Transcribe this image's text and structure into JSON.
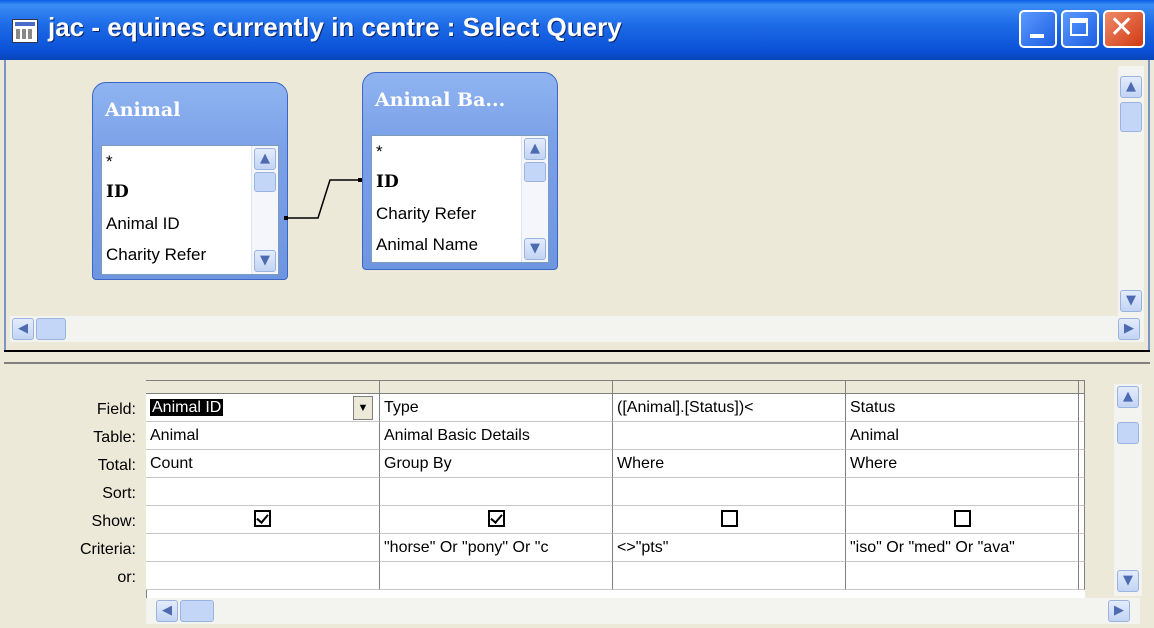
{
  "window": {
    "title": "jac - equines currently in centre : Select Query"
  },
  "tables": [
    {
      "title": "Animal",
      "fields": [
        "*",
        "ID",
        "Animal ID",
        "Charity Refer"
      ]
    },
    {
      "title": "Animal Ba...",
      "fields": [
        "*",
        "ID",
        "Charity Refer",
        "Animal Name"
      ]
    }
  ],
  "grid": {
    "row_labels": [
      "Field:",
      "Table:",
      "Total:",
      "Sort:",
      "Show:",
      "Criteria:",
      "or:"
    ],
    "columns": [
      {
        "field": "Animal ID",
        "table": "Animal",
        "total": "Count",
        "sort": "",
        "show": true,
        "criteria": "",
        "or": ""
      },
      {
        "field": "Type",
        "table": "Animal Basic Details",
        "total": "Group By",
        "sort": "",
        "show": true,
        "criteria": "\"horse\" Or \"pony\" Or \"c",
        "or": ""
      },
      {
        "field": "([Animal].[Status])<",
        "table": "",
        "total": "Where",
        "sort": "",
        "show": false,
        "criteria": "<>\"pts\"",
        "or": ""
      },
      {
        "field": "Status",
        "table": "Animal",
        "total": "Where",
        "sort": "",
        "show": false,
        "criteria": "\"iso\" Or \"med\" Or \"ava\"",
        "or": ""
      }
    ]
  },
  "colors": {
    "titlebar": "#0a5ee6",
    "table_header": "#7aa0e8",
    "face": "#ece9d8"
  }
}
